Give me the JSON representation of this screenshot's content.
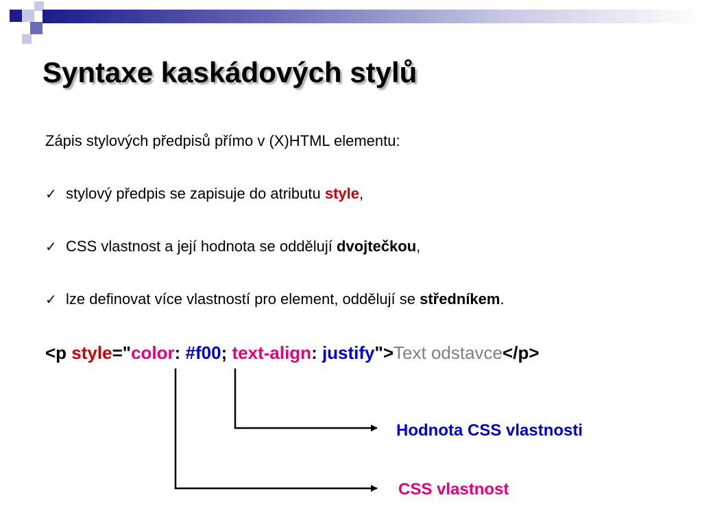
{
  "decoration": {
    "squares": [
      {
        "color": "#1c1c8c"
      },
      {
        "color": "#c8c8e4"
      },
      {
        "color": "#6a6ab8"
      },
      {
        "color": "#c8c8e4"
      },
      {
        "color": "#1c1c8c"
      }
    ],
    "bar_gradient": [
      "#1c1c8c",
      "#6a6ab8",
      "#c8c8e4",
      "#ffffff"
    ]
  },
  "title": "Syntaxe kaskádových stylů",
  "intro": "Zápis stylových předpisů přímo v (X)HTML elementu:",
  "bullets": [
    {
      "check": "✓",
      "text_before": "stylový předpis se zapisuje do atributu ",
      "emphasis": "style",
      "text_after": ","
    },
    {
      "check": "✓",
      "text_before": "CSS vlastnost a její hodnota se oddělují ",
      "emphasis": "dvojtečkou",
      "text_after": ","
    },
    {
      "check": "✓",
      "text_before": "lze definovat více vlastností pro element, oddělují se ",
      "emphasis": "středníkem",
      "text_after": "."
    }
  ],
  "code": {
    "open_tag": "<p ",
    "attr_name": "style",
    "eq_quote": "=\"",
    "prop1": "color",
    "colon1": ": ",
    "value1": "#f00",
    "semicolon": "; ",
    "prop2": "text-align",
    "colon2": ": ",
    "value2": "justify",
    "close_quote": "\">",
    "content": "Text odstavce",
    "close_tag": "</p>"
  },
  "annotations": {
    "value_label": "Hodnota CSS vlastnosti",
    "property_label": "CSS vlastnost"
  },
  "colors": {
    "red": "#cc0000",
    "pink": "#e6007e",
    "blue": "#0000cc",
    "gray": "#808080"
  }
}
